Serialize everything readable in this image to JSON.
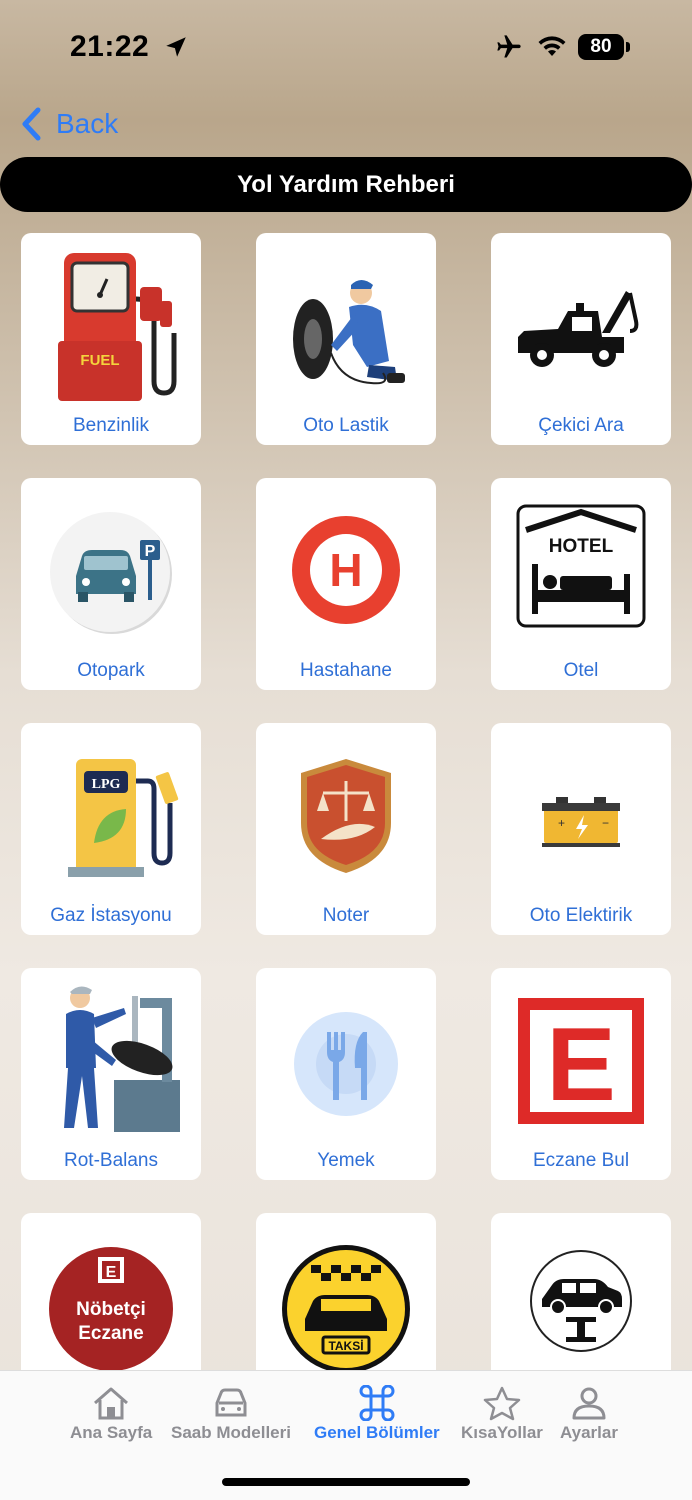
{
  "status": {
    "time": "21:22",
    "battery": "80"
  },
  "nav": {
    "back_label": "Back"
  },
  "page": {
    "title": "Yol Yardım Rehberi"
  },
  "items": [
    {
      "label": "Benzinlik",
      "icon": "fuel-pump-icon"
    },
    {
      "label": "Oto Lastik",
      "icon": "tire-mechanic-icon"
    },
    {
      "label": "Çekici Ara",
      "icon": "tow-truck-icon"
    },
    {
      "label": "Otopark",
      "icon": "parking-icon"
    },
    {
      "label": "Hastahane",
      "icon": "hospital-icon"
    },
    {
      "label": "Otel",
      "icon": "hotel-icon"
    },
    {
      "label": "Gaz İstasyonu",
      "icon": "lpg-station-icon"
    },
    {
      "label": "Noter",
      "icon": "notary-icon"
    },
    {
      "label": "Oto Elektirik",
      "icon": "car-battery-icon"
    },
    {
      "label": "Rot-Balans",
      "icon": "wheel-balancing-icon"
    },
    {
      "label": "Yemek",
      "icon": "restaurant-icon"
    },
    {
      "label": "Eczane Bul",
      "icon": "pharmacy-icon"
    },
    {
      "label": "",
      "icon": "on-duty-pharmacy-icon",
      "badge_line1": "Nöbetçi",
      "badge_line2": "Eczane"
    },
    {
      "label": "",
      "icon": "taxi-icon",
      "badge_text": "TAKSİ"
    },
    {
      "label": "",
      "icon": "car-lift-icon"
    }
  ],
  "icon_text": {
    "fuel": "FUEL",
    "lpg": "LPG",
    "hotel": "HOTEL",
    "hospital": "H",
    "pharmacy": "E"
  },
  "tabs": [
    {
      "label": "Ana Sayfa",
      "icon": "home-icon",
      "active": false
    },
    {
      "label": "Saab Modelleri",
      "icon": "car-icon",
      "active": false
    },
    {
      "label": "Genel Bölümler",
      "icon": "command-icon",
      "active": true
    },
    {
      "label": "KısaYollar",
      "icon": "star-icon",
      "active": false
    },
    {
      "label": "Ayarlar",
      "icon": "person-icon",
      "active": false
    }
  ],
  "colors": {
    "accent": "#2f7cf6",
    "label": "#2f6fd6",
    "inactive": "#8e8e93"
  }
}
